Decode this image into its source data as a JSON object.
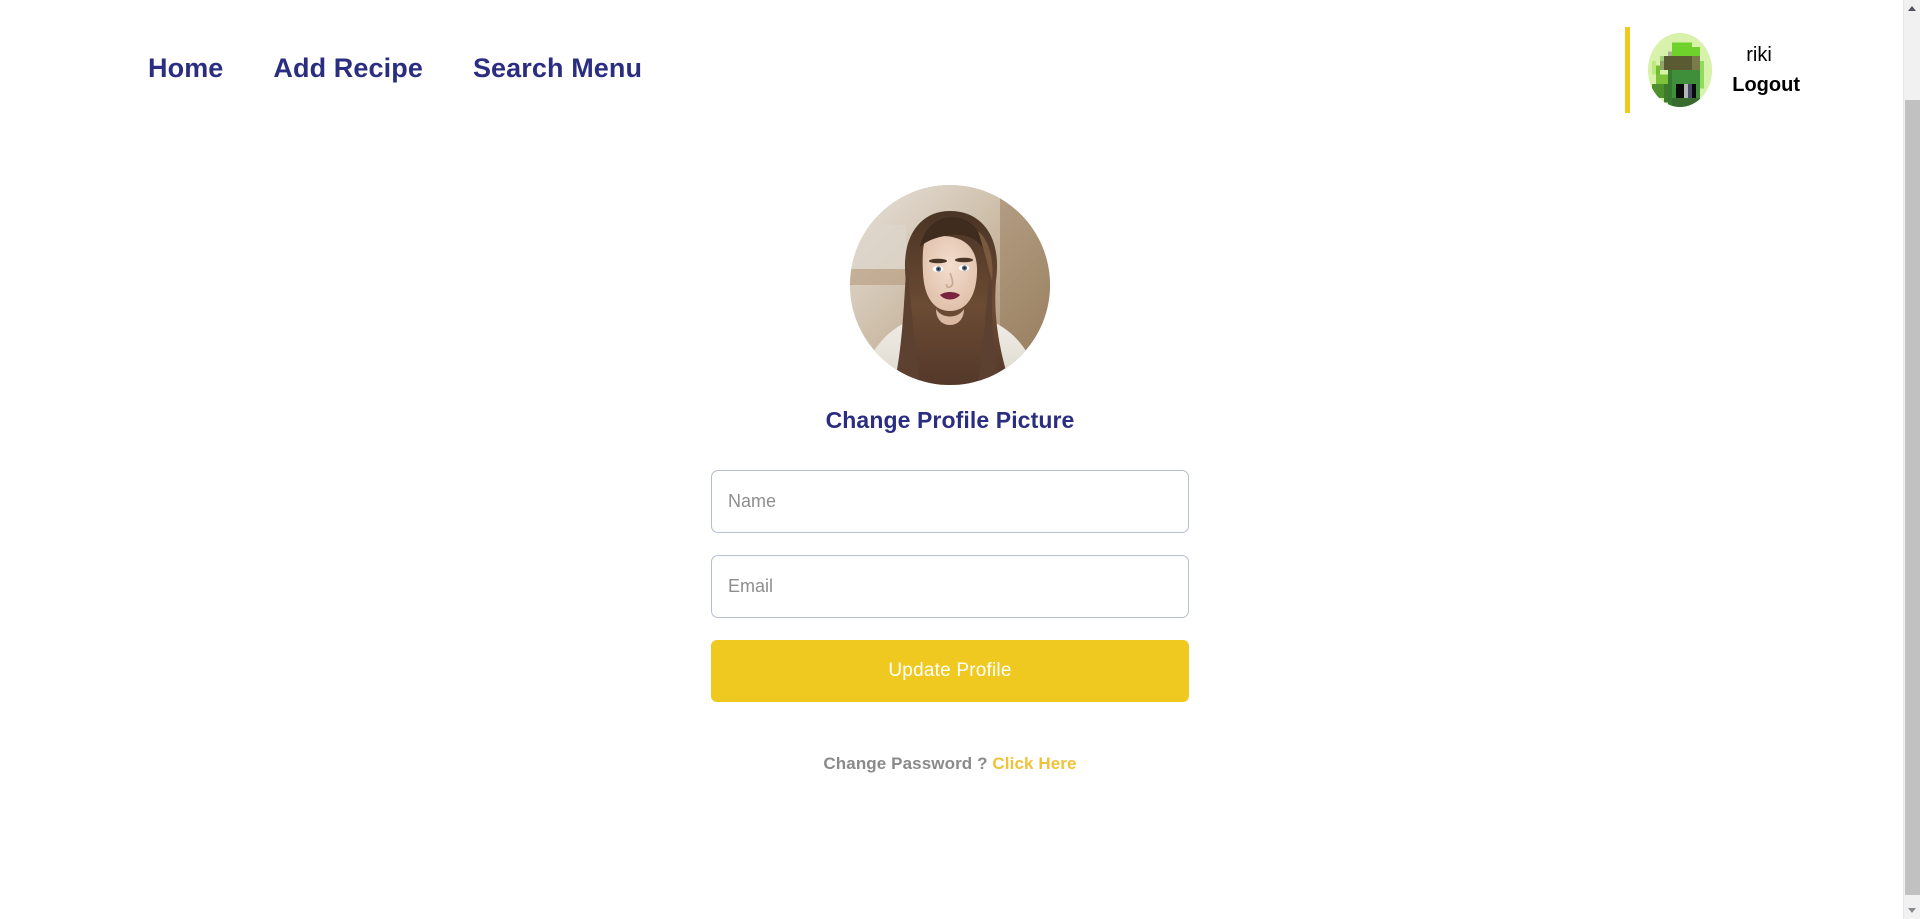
{
  "navbar": {
    "links": [
      {
        "label": "Home",
        "name": "nav-link-home"
      },
      {
        "label": "Add Recipe",
        "name": "nav-link-add-recipe"
      },
      {
        "label": "Search Menu",
        "name": "nav-link-search-menu"
      }
    ],
    "user": {
      "username": "riki",
      "logout_label": "Logout",
      "avatar_icon": "pixel-avatar-icon",
      "divider_color": "#efc91f"
    },
    "link_color": "#2b2e80"
  },
  "main": {
    "profile_picture_icon": "profile-photo",
    "change_picture_label": "Change Profile Picture",
    "fields": [
      {
        "name": "name-input",
        "placeholder": "Name",
        "value": ""
      },
      {
        "name": "email-input",
        "placeholder": "Email",
        "value": ""
      }
    ],
    "update_button_label": "Update Profile",
    "change_password": {
      "prompt": "Change Password ?",
      "link_label": "Click Here"
    }
  },
  "theme": {
    "accent_yellow": "#efc91f",
    "link_yellow": "#efc238",
    "navy": "#2b2e80",
    "muted_gray": "#8a8a8a",
    "input_border": "#b6bfd0"
  }
}
